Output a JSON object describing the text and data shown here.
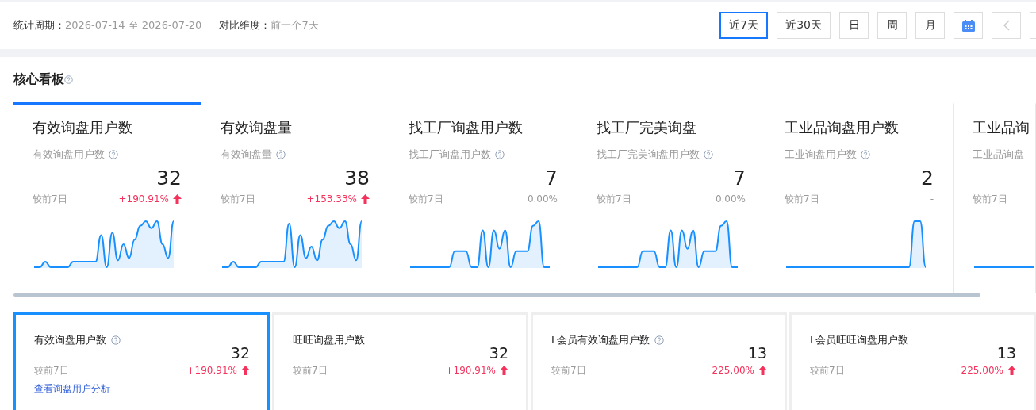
{
  "filter_bar": {
    "period_label": "统计周期：",
    "period_value": "2026-07-14 至 2026-07-20",
    "compare_label": "对比维度：",
    "compare_value": "前一个7天",
    "ranges": [
      {
        "label": "近7天",
        "selected": true
      },
      {
        "label": "近30天",
        "selected": false
      },
      {
        "label": "日",
        "selected": false
      },
      {
        "label": "周",
        "selected": false
      },
      {
        "label": "月",
        "selected": false
      }
    ],
    "prev_disabled": true
  },
  "board": {
    "title": "核心看板",
    "tabs": [
      {
        "title": "有效询盘用户数",
        "subtitle": "有效询盘用户数",
        "value": "32",
        "compare_label": "较前7日",
        "change": "+190.91%",
        "rising": true,
        "selected": true
      },
      {
        "title": "有效询盘量",
        "subtitle": "有效询盘量",
        "value": "38",
        "compare_label": "较前7日",
        "change": "+153.33%",
        "rising": true,
        "selected": false
      },
      {
        "title": "找工厂询盘用户数",
        "subtitle": "找工厂询盘用户数",
        "value": "7",
        "compare_label": "较前7日",
        "change": "0.00%",
        "rising": false,
        "selected": false
      },
      {
        "title": "找工厂完美询盘",
        "subtitle": "找工厂完美询盘用户数",
        "value": "7",
        "compare_label": "较前7日",
        "change": "0.00%",
        "rising": false,
        "selected": false
      },
      {
        "title": "工业品询盘用户数",
        "subtitle": "工业询盘用户数",
        "value": "2",
        "compare_label": "较前7日",
        "change": "-",
        "rising": false,
        "selected": false
      },
      {
        "title": "工业品询",
        "subtitle": "工业品询盘",
        "compare_label": "较前7日",
        "selected": false
      }
    ],
    "cards": [
      {
        "title": "有效询盘用户数",
        "help": true,
        "value": "32",
        "compare_label": "较前7日",
        "change": "+190.91%",
        "rising": true,
        "link": "查看询盘用户分析",
        "selected": true
      },
      {
        "title": "旺旺询盘用户数",
        "help": false,
        "value": "32",
        "compare_label": "较前7日",
        "change": "+190.91%",
        "rising": true,
        "selected": false
      },
      {
        "title": "L会员有效询盘用户数",
        "help": true,
        "value": "13",
        "compare_label": "较前7日",
        "change": "+225.00%",
        "rising": true,
        "selected": false
      },
      {
        "title": "L会员旺旺询盘用户数",
        "help": false,
        "value": "13",
        "compare_label": "较前7日",
        "change": "+225.00%",
        "rising": true,
        "selected": false
      }
    ]
  }
}
